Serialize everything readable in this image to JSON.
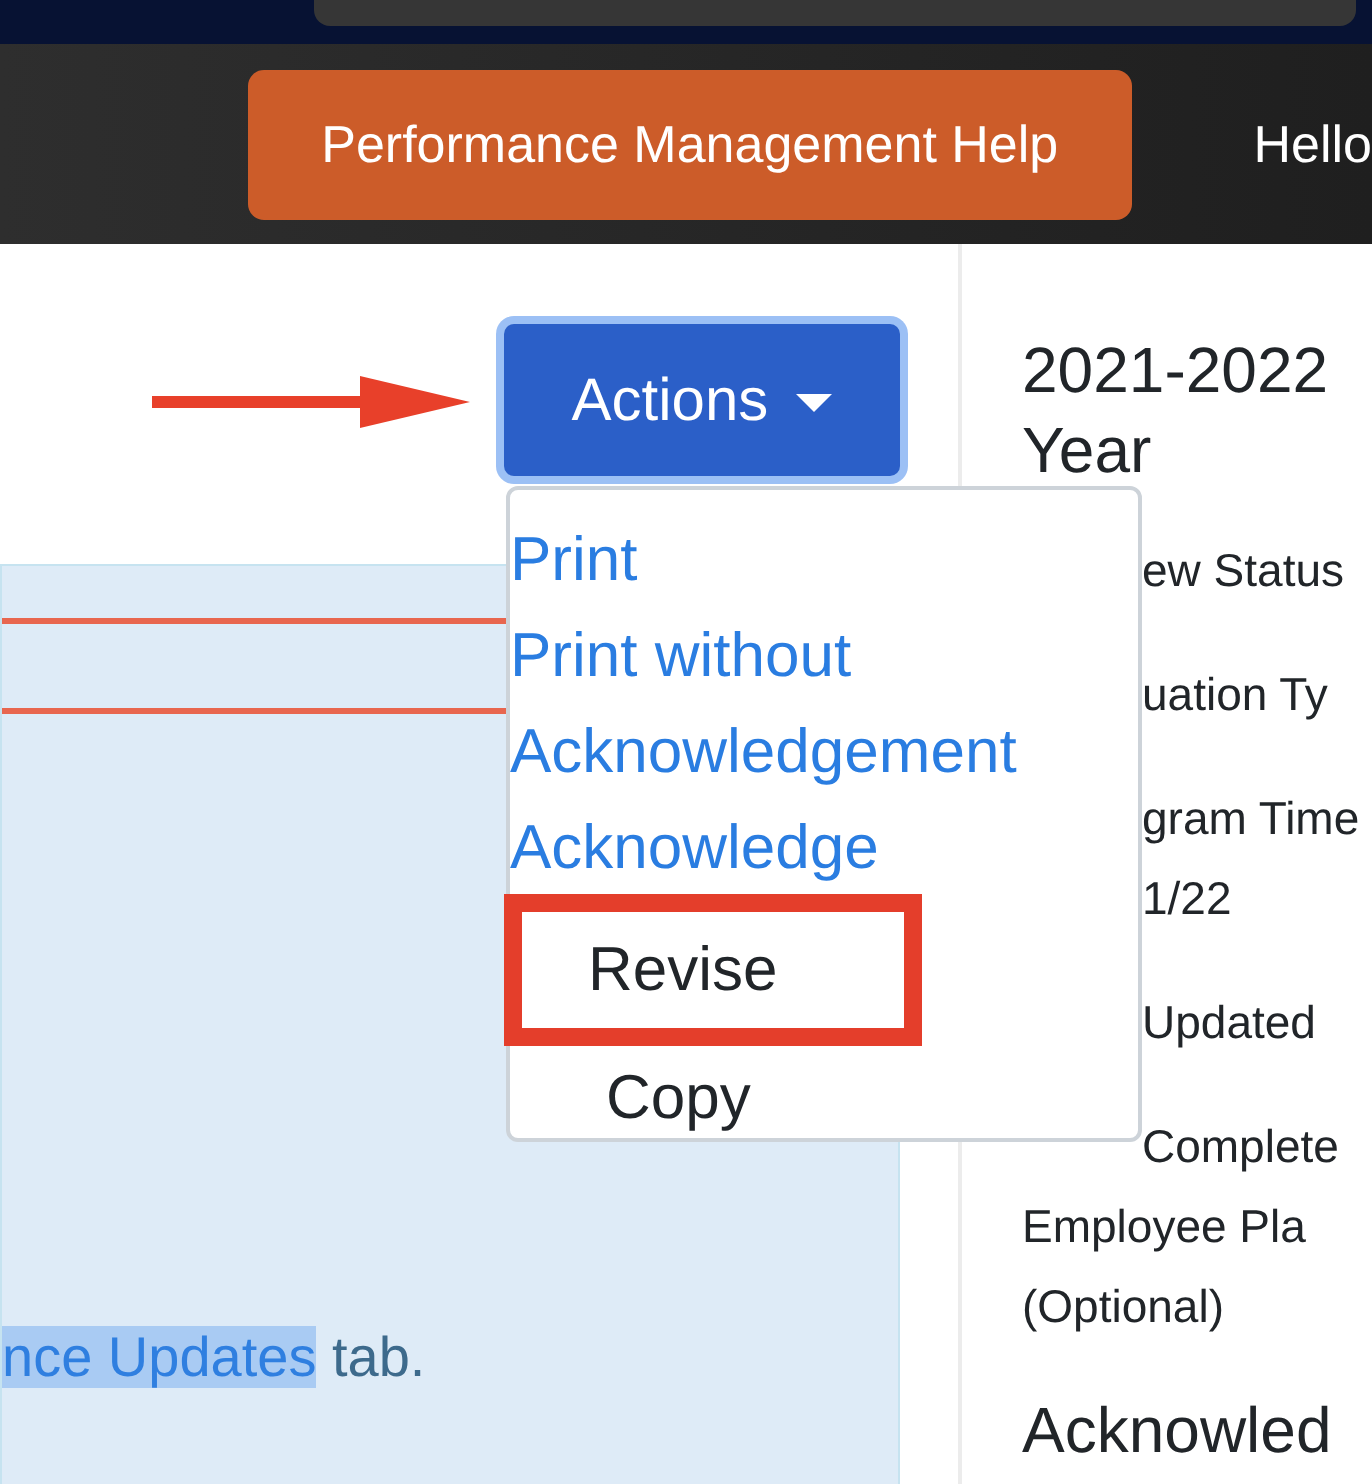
{
  "header": {
    "help_button": "Performance Management Help",
    "greeting": "Hello"
  },
  "actions": {
    "label": "Actions",
    "focused": true,
    "menu": [
      {
        "label": "Print",
        "kind": "link",
        "highlighted": false
      },
      {
        "label": "Print without",
        "kind": "link",
        "highlighted": false
      },
      {
        "label": "Acknowledgement",
        "kind": "link",
        "highlighted": false
      },
      {
        "label": "Acknowledge",
        "kind": "link",
        "highlighted": false
      },
      {
        "label": "Revise",
        "kind": "plain",
        "highlighted": true
      },
      {
        "label": "Copy",
        "kind": "plain",
        "highlighted": false
      }
    ]
  },
  "notice": {
    "link": "nce Updates",
    "text": " tab."
  },
  "summary": {
    "title": "2021-2022 Year",
    "details": [
      {
        "lines": [
          {
            "text": "ew Status",
            "covered": true
          }
        ]
      },
      {
        "lines": [
          {
            "text": "uation Ty",
            "covered": true
          }
        ]
      },
      {
        "lines": [
          {
            "text": "gram Time",
            "covered": true
          },
          {
            "text": "1/22",
            "covered": true
          }
        ]
      },
      {
        "lines": [
          {
            "text": "Updated",
            "covered": true
          }
        ]
      },
      {
        "lines": [
          {
            "text": "Complete",
            "covered": true
          },
          {
            "text": "Employee Pla",
            "covered": false
          },
          {
            "text": "(Optional)",
            "covered": false
          }
        ]
      }
    ],
    "section_heading": "Acknowled"
  }
}
